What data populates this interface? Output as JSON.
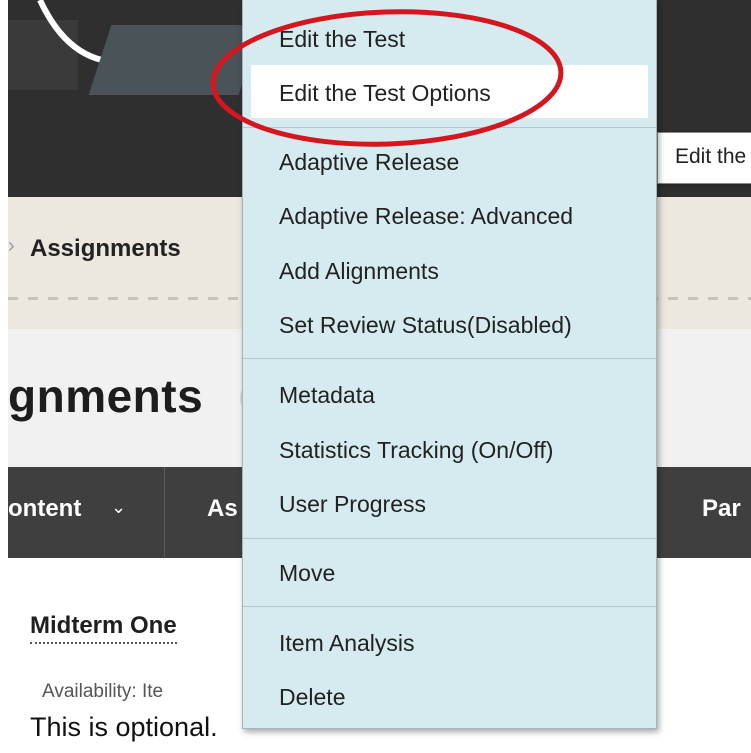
{
  "breadcrumb": {
    "separator": "›",
    "current": "Assignments"
  },
  "page": {
    "title": "gnments"
  },
  "nav": {
    "tab_content": "ontent",
    "tab_content_chevron": "⌄",
    "tab_as": "As",
    "tab_par": "Par"
  },
  "content": {
    "item_title": "Midterm One",
    "availability": "Availability:  Ite",
    "description": "This is optional."
  },
  "tooltip": {
    "text": "Edit the"
  },
  "menu": {
    "items": [
      "Edit the Test",
      "Edit the Test Options",
      "Adaptive Release",
      "Adaptive Release: Advanced",
      "Add Alignments",
      "Set Review Status(Disabled)",
      "Metadata",
      "Statistics Tracking (On/Off)",
      "User Progress",
      "Move",
      "Item Analysis",
      "Delete"
    ],
    "highlighted_index": 1
  },
  "colors": {
    "menu_bg": "#d5ebf0",
    "annotation": "#d6161f",
    "banner": "#2f2f2f",
    "nav": "#3f3f3f"
  }
}
